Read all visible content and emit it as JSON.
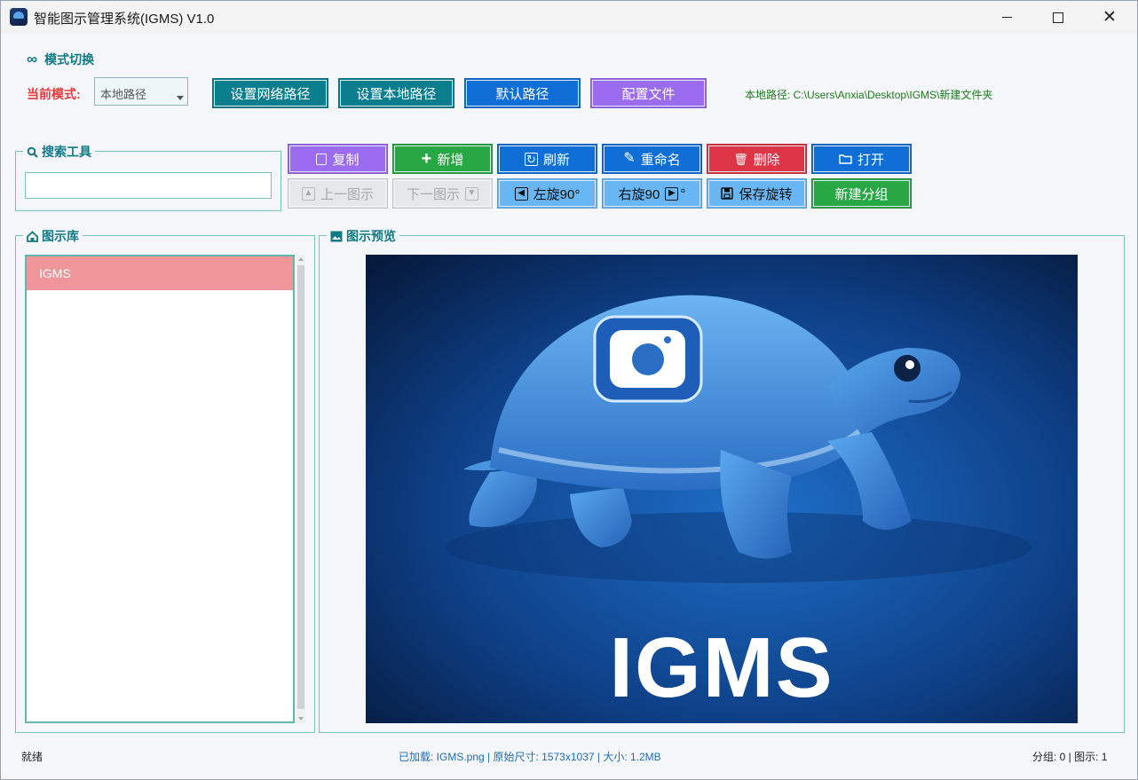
{
  "window": {
    "title": "智能图示管理系统(IGMS) V1.0",
    "controls": {
      "minimize": "—",
      "maximize": "☐",
      "close": "✕"
    }
  },
  "mode": {
    "section_title": "模式切换",
    "current_label": "当前模式:",
    "selected": "本地路径",
    "buttons": {
      "network_path": "设置网络路径",
      "local_path": "设置本地路径",
      "default_path": "默认路径",
      "config_file": "配置文件"
    },
    "path_display": "本地路径: C:\\Users\\Anxia\\Desktop\\IGMS\\新建文件夹"
  },
  "search": {
    "title": "搜索工具",
    "value": ""
  },
  "toolbar": {
    "copy": "复制",
    "add": "新增",
    "refresh": "刷新",
    "rename": "重命名",
    "delete": "删除",
    "open": "打开",
    "prev": "上一图示",
    "next": "下一图示",
    "rotate_left": "左旋90°",
    "rotate_right": "右旋90",
    "rotate_right_suffix": "°",
    "save_rotation": "保存旋转",
    "new_group": "新建分组"
  },
  "library": {
    "title": "图示库",
    "items": [
      "IGMS"
    ]
  },
  "preview": {
    "title": "图示预览",
    "image_text": "IGMS"
  },
  "status": {
    "left": "就绪",
    "middle": "已加载: IGMS.png | 原始尺寸: 1573x1037 | 大小: 1.2MB",
    "right": "分组: 0 | 图示: 1"
  },
  "colors": {
    "teal_button": "#0b7e8e",
    "blue_button": "#0f6fd6",
    "purple_button": "#9b6cf0",
    "green_button": "#28a745",
    "red_button": "#dc3545",
    "light_blue_button": "#68b6f3",
    "disabled_button": "#e6e7ea",
    "accent_teal": "#117a84",
    "mode_label_red": "#e53b3b",
    "list_selected": "#f0959a"
  }
}
